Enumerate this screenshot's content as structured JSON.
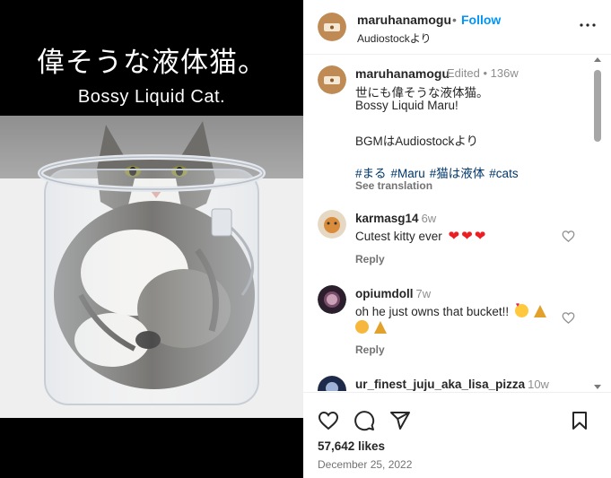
{
  "media": {
    "caption_jp": "偉そうな液体猫。",
    "caption_en": "Bossy Liquid Cat."
  },
  "header": {
    "username": "maruhanamogu",
    "separator": "•",
    "follow_label": "Follow",
    "subtitle": "Audiostockより",
    "more_icon": "more-horizontal-icon"
  },
  "caption": {
    "username": "maruhanamogu",
    "meta": "Edited  •  136w",
    "lines": [
      "世にも偉そうな液体猫。",
      "Bossy Liquid Maru!",
      "",
      "BGMはAudiostockより"
    ],
    "hashtags": [
      "#まる",
      "#Maru",
      "#猫は液体",
      "#cats"
    ],
    "see_translation": "See translation"
  },
  "comments": [
    {
      "username": "karmasg14",
      "time": "6w",
      "text": "Cutest kitty ever",
      "emoji_icons": [
        "red-heart-icon",
        "red-heart-icon",
        "red-heart-icon"
      ],
      "reply_label": "Reply"
    },
    {
      "username": "opiumdoll",
      "time": "7w",
      "text": "oh he just owns that bucket!!",
      "emoji_icons": [
        "smiling-face-with-hearts-icon",
        "party-popper-icon",
        "cat-icon",
        "party-popper-icon"
      ],
      "reply_label": "Reply"
    },
    {
      "username": "ur_finest_juju_aka_lisa_pizza",
      "time": "10w"
    }
  ],
  "actions": {
    "icons": [
      "like-heart-icon",
      "comment-icon",
      "share-icon",
      "save-bookmark-icon"
    ],
    "likes": "57,642 likes",
    "date": "December 25, 2022"
  },
  "colors": {
    "link_blue": "#0095f6",
    "hashtag": "#00376b",
    "muted": "#737373",
    "heart_red": "#ed1d24"
  }
}
